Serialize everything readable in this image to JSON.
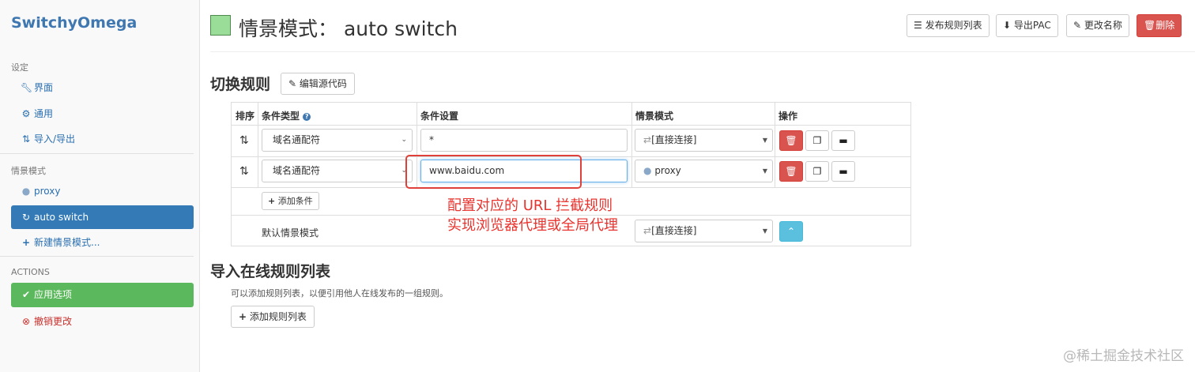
{
  "sidebar": {
    "brand": "SwitchyOmega",
    "settings_heading": "设定",
    "settings_items": [
      {
        "label": "界面",
        "icon": "wrench-icon"
      },
      {
        "label": "通用",
        "icon": "gear-icon"
      },
      {
        "label": "导入/导出",
        "icon": "import-export-icon"
      }
    ],
    "profiles_heading": "情景模式",
    "profiles": [
      {
        "label": "proxy",
        "icon": "globe-icon"
      },
      {
        "label": "auto switch",
        "icon": "switch-icon",
        "active": true
      }
    ],
    "new_profile": "新建情景模式...",
    "actions_heading": "ACTIONS",
    "apply": "应用选项",
    "discard": "撤销更改"
  },
  "header": {
    "title": "情景模式： auto switch",
    "swatch_color": "#99dd99",
    "buttons": {
      "publish": "发布规则列表",
      "export_pac": "导出PAC",
      "rename": "更改名称",
      "delete": "删除"
    }
  },
  "switch_rules": {
    "heading": "切换规则",
    "edit_source": "编辑源代码",
    "columns": [
      "排序",
      "条件类型",
      "条件设置",
      "情景模式",
      "操作"
    ],
    "rows": [
      {
        "condition_type": "域名通配符",
        "condition": "*",
        "profile": "[直接连接]",
        "profile_icon": "arrows-icon"
      },
      {
        "condition_type": "域名通配符",
        "condition": "www.baidu.com",
        "profile": "proxy",
        "profile_icon": "globe-icon"
      }
    ],
    "add_condition": "添加条件",
    "default_label": "默认情景模式",
    "default_profile": "[直接连接]"
  },
  "annotation": {
    "line1": "配置对应的 URL 拦截规则",
    "line2": "实现浏览器代理或全局代理",
    "color": "#e8332e"
  },
  "online_rules": {
    "heading": "导入在线规则列表",
    "description": "可以添加规则列表，以便引用他人在线发布的一组规则。",
    "add_button": "添加规则列表"
  },
  "watermark": "@稀土掘金技术社区",
  "colors": {
    "primary": "#337ab7",
    "success": "#5cb85c",
    "danger": "#d9534f",
    "info": "#5bc0de"
  }
}
